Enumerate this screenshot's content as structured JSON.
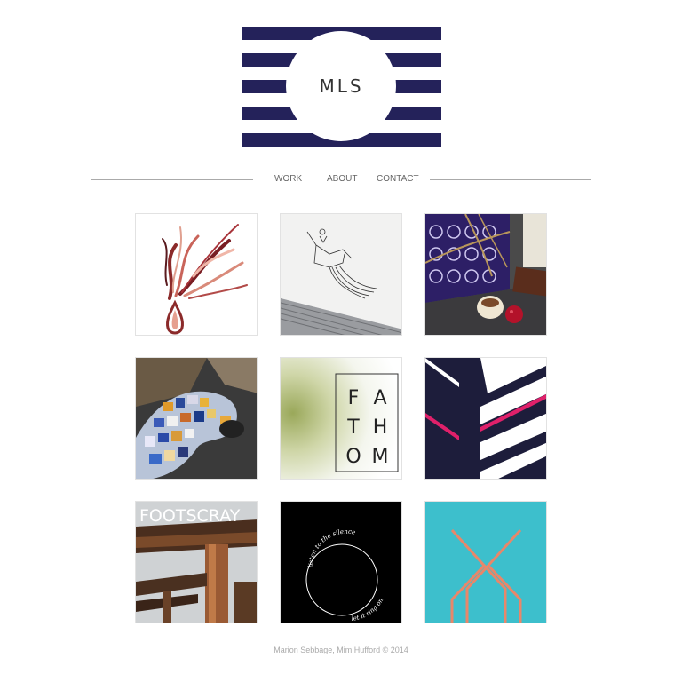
{
  "logo": {
    "text": "MLS",
    "stripe_color": "#24225a"
  },
  "nav": {
    "work": "WORK",
    "about": "ABOUT",
    "contact": "CONTACT"
  },
  "tiles": {
    "fathom": [
      "F",
      "A",
      "T",
      "H",
      "O",
      "M"
    ],
    "footscray": "FOOTSCRAY",
    "circle_top": "listen to the silence",
    "circle_bottom": "let it ring on"
  },
  "footer": "Marion Sebbage, Mim Hufford © 2014"
}
